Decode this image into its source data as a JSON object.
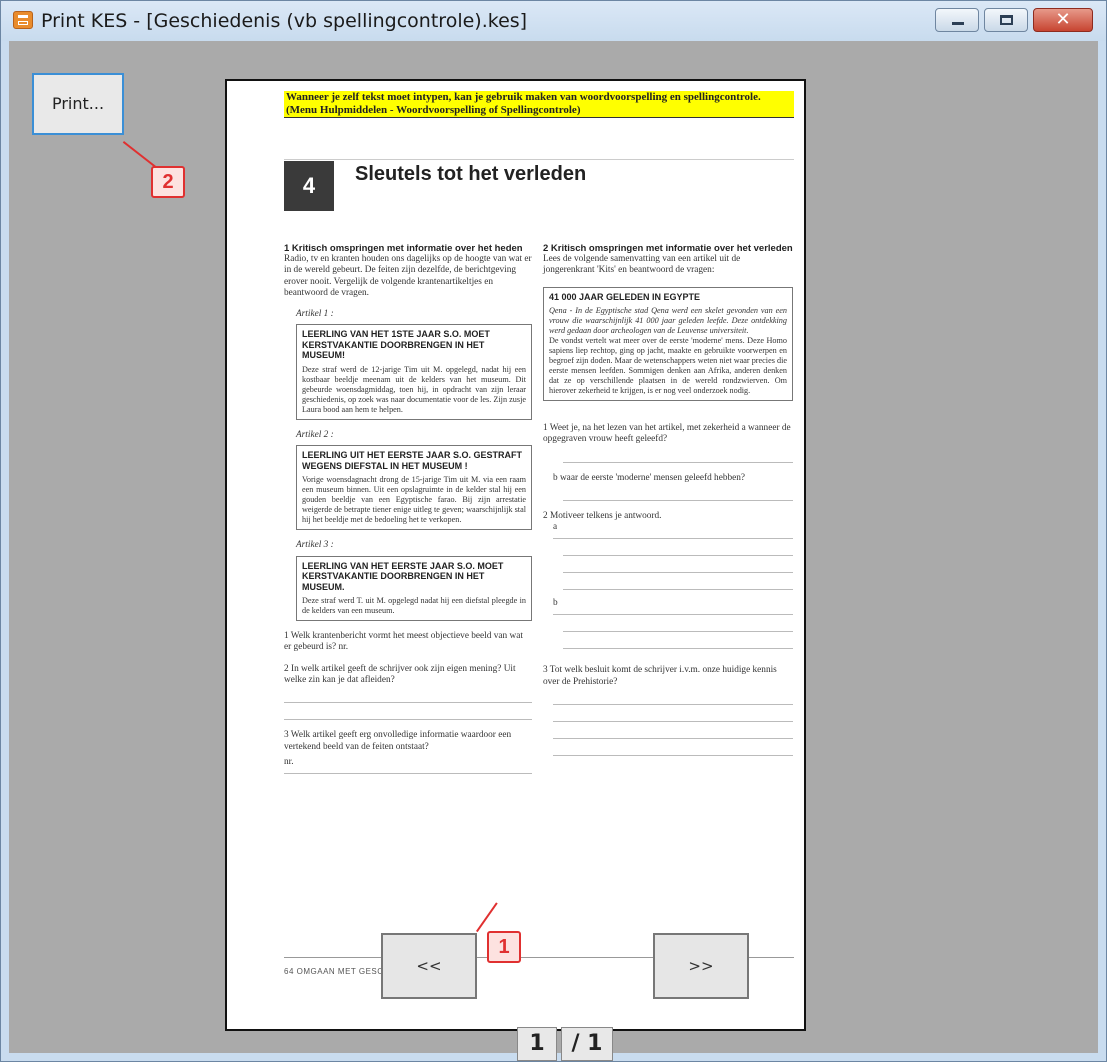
{
  "window": {
    "title": "Print KES - [Geschiedenis (vb spellingcontrole).kes]",
    "icon": "printer-icon",
    "controls": {
      "minimize": "minimize-icon",
      "maximize": "maximize-icon",
      "close_glyph": "✕"
    }
  },
  "toolbar": {
    "print_label": "Print..."
  },
  "callouts": {
    "first": "1",
    "second": "2"
  },
  "document": {
    "highlight": "Wanneer je zelf tekst moet intypen, kan je gebruik maken van woordvoorspelling en spellingcontrole. (Menu Hulpmiddelen - Woordvoorspelling of Spellingcontrole)",
    "chapter_number": "4",
    "chapter_title": "Sleutels tot het verleden",
    "left": {
      "heading": "1 Kritisch omspringen met informatie over het heden",
      "intro": "Radio, tv en kranten houden ons dagelijks op de hoogte van wat er in de wereld gebeurt. De feiten zijn dezelfde, de berichtgeving erover nooit. Vergelijk de volgende krantenartikeltjes en beantwoord de vragen.",
      "art1_label": "Artikel 1 :",
      "art1_head": "LEERLING VAN HET 1STE JAAR S.O. MOET KERSTVAKANTIE DOORBRENGEN IN HET MUSEUM!",
      "art1_body": "Deze straf werd de 12-jarige Tim uit M. opgelegd, nadat hij een kostbaar beeldje meenam uit de kelders van het museum. Dit gebeurde woensdagmiddag, toen hij, in opdracht van zijn leraar geschiedenis, op zoek was naar documentatie voor de les. Zijn zusje Laura bood aan hem te helpen.",
      "art2_label": "Artikel 2 :",
      "art2_head": "LEERLING UIT HET EERSTE JAAR S.O. GESTRAFT WEGENS DIEFSTAL IN HET MUSEUM !",
      "art2_body": "Vorige woensdagnacht drong de 15-jarige Tim uit M. via een raam een museum binnen. Uit een opslagruimte in de kelder stal hij een gouden beeldje van een Egyptische farao. Bij zijn arrestatie weigerde de betrapte tiener enige uitleg te geven; waarschijnlijk stal hij het beeldje met de bedoeling het te verkopen.",
      "art3_label": "Artikel 3 :",
      "art3_head": "LEERLING VAN HET EERSTE JAAR S.O. MOET KERSTVAKANTIE DOORBRENGEN IN HET MUSEUM.",
      "art3_body": "Deze straf werd T. uit M. opgelegd nadat hij een diefstal pleegde in de kelders van een museum.",
      "q1": "1 Welk krantenbericht vormt het meest objectieve beeld van wat er gebeurd is? nr.",
      "q2": "2 In welk artikel geeft de schrijver ook zijn eigen mening? Uit welke zin kan je dat afleiden?",
      "q3": "3 Welk artikel geeft erg onvolledige informatie waardoor een vertekend beeld van de feiten ontstaat?",
      "q3_nr": "nr."
    },
    "right": {
      "heading": "2 Kritisch omspringen met informatie over het verleden",
      "intro": "Lees de volgende samenvatting van een artikel uit de jongerenkrant 'Kits' en beantwoord de vragen:",
      "box_head": "41 000 JAAR GELEDEN IN EGYPTE",
      "box_lead": "Qena - In de Egyptische stad Qena werd een skelet gevonden van een vrouw die waarschijnlijk 41 000 jaar geleden leefde. Deze ontdekking werd gedaan door archeologen van de Leuvense universiteit.",
      "box_body": "De vondst vertelt wat meer over de eerste 'moderne' mens. Deze Homo sapiens liep rechtop, ging op jacht, maakte en gebruikte voorwerpen en begroef zijn doden. Maar de wetenschappers weten niet waar precies die eerste mensen leefden. Sommigen denken aan Afrika, anderen denken dat ze op verschillende plaatsen in de wereld rondzwierven. Om hierover zekerheid te krijgen, is er nog veel onderzoek nodig.",
      "q1a": "1 Weet je, na het lezen van het artikel, met zekerheid a wanneer de opgegraven vrouw heeft geleefd?",
      "q1b": "b waar de eerste 'moderne' mensen geleefd hebben?",
      "q2": "2 Motiveer telkens je antwoord.",
      "q2a": "a",
      "q2b": "b",
      "q3": "3 Tot welk besluit komt de schrijver i.v.m. onze huidige kennis over de Prehistorie?"
    },
    "footer": "64     OMGAAN MET GESCHIEDENIS"
  },
  "nav": {
    "prev_label": "<<",
    "next_label": ">>",
    "current_page": "1",
    "total_pages": "/ 1"
  }
}
